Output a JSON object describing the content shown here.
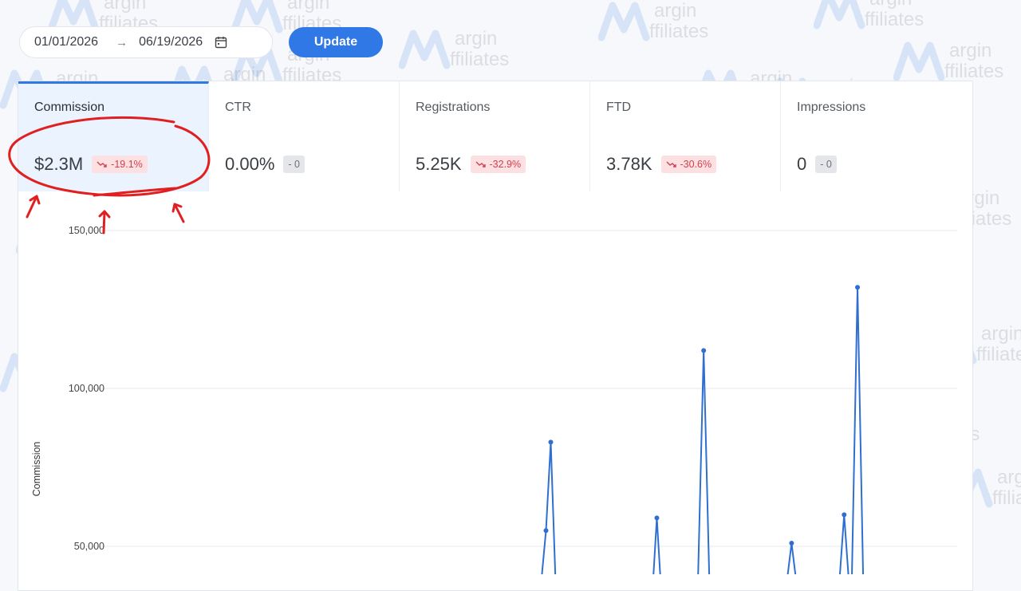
{
  "date_range": {
    "start": "01/01/2026",
    "end": "06/19/2026",
    "arrow_icon": "right-arrow-icon",
    "calendar_icon": "calendar-icon"
  },
  "update_button": {
    "label": "Update"
  },
  "metrics": [
    {
      "label": "Commission",
      "value": "$2.3M",
      "change": "-19.1%",
      "trend": "down",
      "active": true
    },
    {
      "label": "CTR",
      "value": "0.00%",
      "change": "- 0",
      "trend": "neutral",
      "active": false
    },
    {
      "label": "Registrations",
      "value": "5.25K",
      "change": "-32.9%",
      "trend": "down",
      "active": false
    },
    {
      "label": "FTD",
      "value": "3.78K",
      "change": "-30.6%",
      "trend": "down",
      "active": false
    },
    {
      "label": "Impressions",
      "value": "0",
      "change": "- 0",
      "trend": "neutral",
      "active": false
    }
  ],
  "watermark": {
    "line1": "argin",
    "line2": "ffiliates"
  },
  "colors": {
    "accent": "#2f78e6",
    "negative": "#d04050",
    "negative_bg": "#fde0e2",
    "annotation": "#e02020"
  },
  "chart_data": {
    "type": "line",
    "ylabel": "Commission",
    "y_ticks": [
      "150,000",
      "100,000",
      "50,000"
    ],
    "ylim": [
      0,
      150000
    ],
    "grid": true,
    "series": [
      {
        "values": [
          [
            0.05,
            0
          ],
          [
            0.548,
            0
          ],
          [
            0.553,
            55000
          ],
          [
            0.558,
            83000
          ],
          [
            0.563,
            0
          ],
          [
            0.665,
            0
          ],
          [
            0.669,
            59000
          ],
          [
            0.673,
            0
          ],
          [
            0.712,
            0
          ],
          [
            0.718,
            112000
          ],
          [
            0.724,
            0
          ],
          [
            0.805,
            0
          ],
          [
            0.81,
            51000
          ],
          [
            0.815,
            0
          ],
          [
            0.86,
            0
          ],
          [
            0.865,
            60000
          ],
          [
            0.87,
            0
          ],
          [
            0.873,
            0
          ],
          [
            0.879,
            132000
          ],
          [
            0.885,
            0
          ]
        ]
      }
    ]
  }
}
